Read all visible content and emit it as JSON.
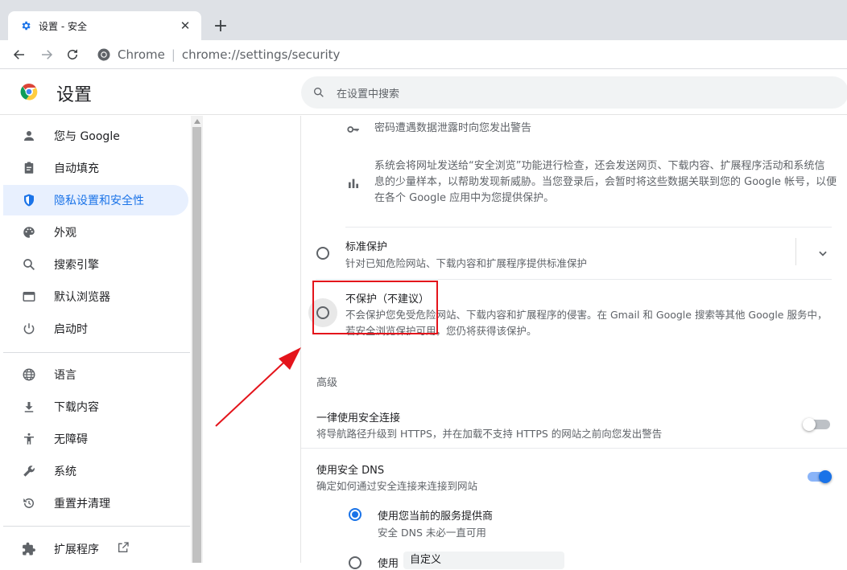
{
  "tab": {
    "title": "设置 - 安全",
    "close": "✕",
    "new_tab": "+"
  },
  "omnibox": {
    "brand": "Chrome",
    "separator": "|",
    "url": "chrome://settings/security"
  },
  "header": {
    "title": "设置",
    "search_placeholder": "在设置中搜索"
  },
  "sidebar": {
    "items": [
      {
        "label": "您与 Google",
        "icon": "person-icon"
      },
      {
        "label": "自动填充",
        "icon": "clipboard-icon"
      },
      {
        "label": "隐私设置和安全性",
        "icon": "shield-icon",
        "active": true
      },
      {
        "label": "外观",
        "icon": "palette-icon"
      },
      {
        "label": "搜索引擎",
        "icon": "search-icon"
      },
      {
        "label": "默认浏览器",
        "icon": "browser-icon"
      },
      {
        "label": "启动时",
        "icon": "power-icon"
      },
      {
        "label": "语言",
        "icon": "globe-icon"
      },
      {
        "label": "下载内容",
        "icon": "download-icon"
      },
      {
        "label": "无障碍",
        "icon": "accessibility-icon"
      },
      {
        "label": "系统",
        "icon": "wrench-icon"
      },
      {
        "label": "重置并清理",
        "icon": "restore-icon"
      },
      {
        "label": "扩展程序",
        "icon": "puzzle-icon",
        "external": true
      }
    ]
  },
  "main": {
    "password_warning": "密码遭遇数据泄露时向您发出警告",
    "safe_browsing_data": {
      "line1": "系统会将网址发送给“安全浏览”功能进行检查，还会发送网页、下载内容、扩展程序活动和系统信",
      "line2": "息的少量样本，以帮助发现新威胁。当您登录后，会暂时将这些数据关联到您的 Google 帐号，以便",
      "line3": "在各个 Google 应用中为您提供保护。"
    },
    "standard": {
      "title": "标准保护",
      "desc": "针对已知危险网站、下载内容和扩展程序提供标准保护"
    },
    "no_protection": {
      "title": "不保护（不建议）",
      "desc1": "不会保护您免受危险网站、下载内容和扩展程序的侵害。在 Gmail 和 Google 搜索等其他 Google 服务中，",
      "desc2": "若安全浏览保护可用，您仍将获得该保护。"
    },
    "advanced_heading": "高级",
    "https": {
      "title": "一律使用安全连接",
      "desc": "将导航路径升级到 HTTPS，并在加载不支持 HTTPS 的网站之前向您发出警告",
      "enabled": false
    },
    "dns": {
      "title": "使用安全 DNS",
      "desc": "确定如何通过安全连接来连接到网站",
      "enabled": true
    },
    "dns_current": {
      "title": "使用您当前的服务提供商",
      "desc": "安全 DNS 未必一直可用"
    },
    "dns_custom": {
      "label": "使用",
      "select_value": "自定义"
    }
  },
  "colors": {
    "accent": "#1a73e8",
    "annotation": "#e4141b"
  }
}
